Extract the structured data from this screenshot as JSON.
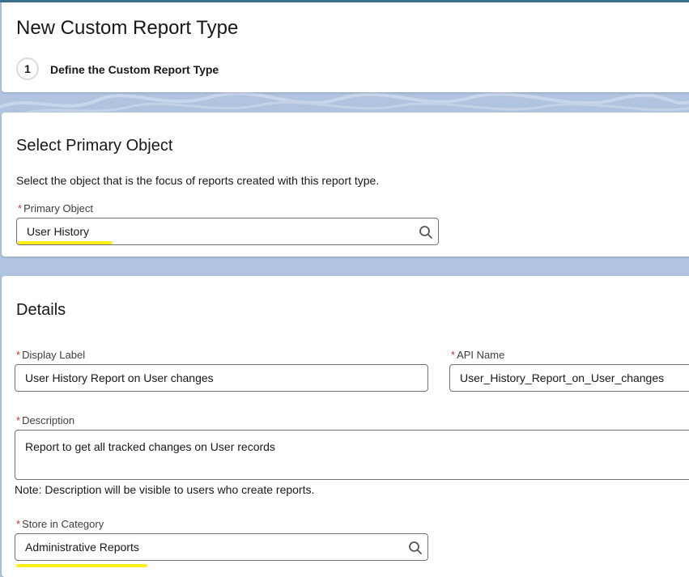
{
  "header": {
    "title": "New Custom Report Type",
    "step_number": "1",
    "step_label": "Define the Custom Report Type"
  },
  "primary_object_section": {
    "title": "Select Primary Object",
    "help_text": "Select the object that is the focus of reports created with this report type.",
    "required_marker": "*",
    "primary_object_label": "Primary Object",
    "primary_object_value": "User History"
  },
  "details_section": {
    "title": "Details",
    "required_marker": "*",
    "display_label_label": "Display Label",
    "display_label_value": "User History Report on User changes",
    "api_name_label": "API Name",
    "api_name_value": "User_History_Report_on_User_changes",
    "description_label": "Description",
    "description_value": "Report to get all tracked changes on User records",
    "description_note": "Note: Description will be visible to users who create reports.",
    "category_label": "Store in Category",
    "category_value": "Administrative Reports"
  },
  "colors": {
    "highlight": "#ffef1a",
    "background": "#b0c4df",
    "required": "#c23934"
  },
  "icons": [
    "search-icon"
  ]
}
